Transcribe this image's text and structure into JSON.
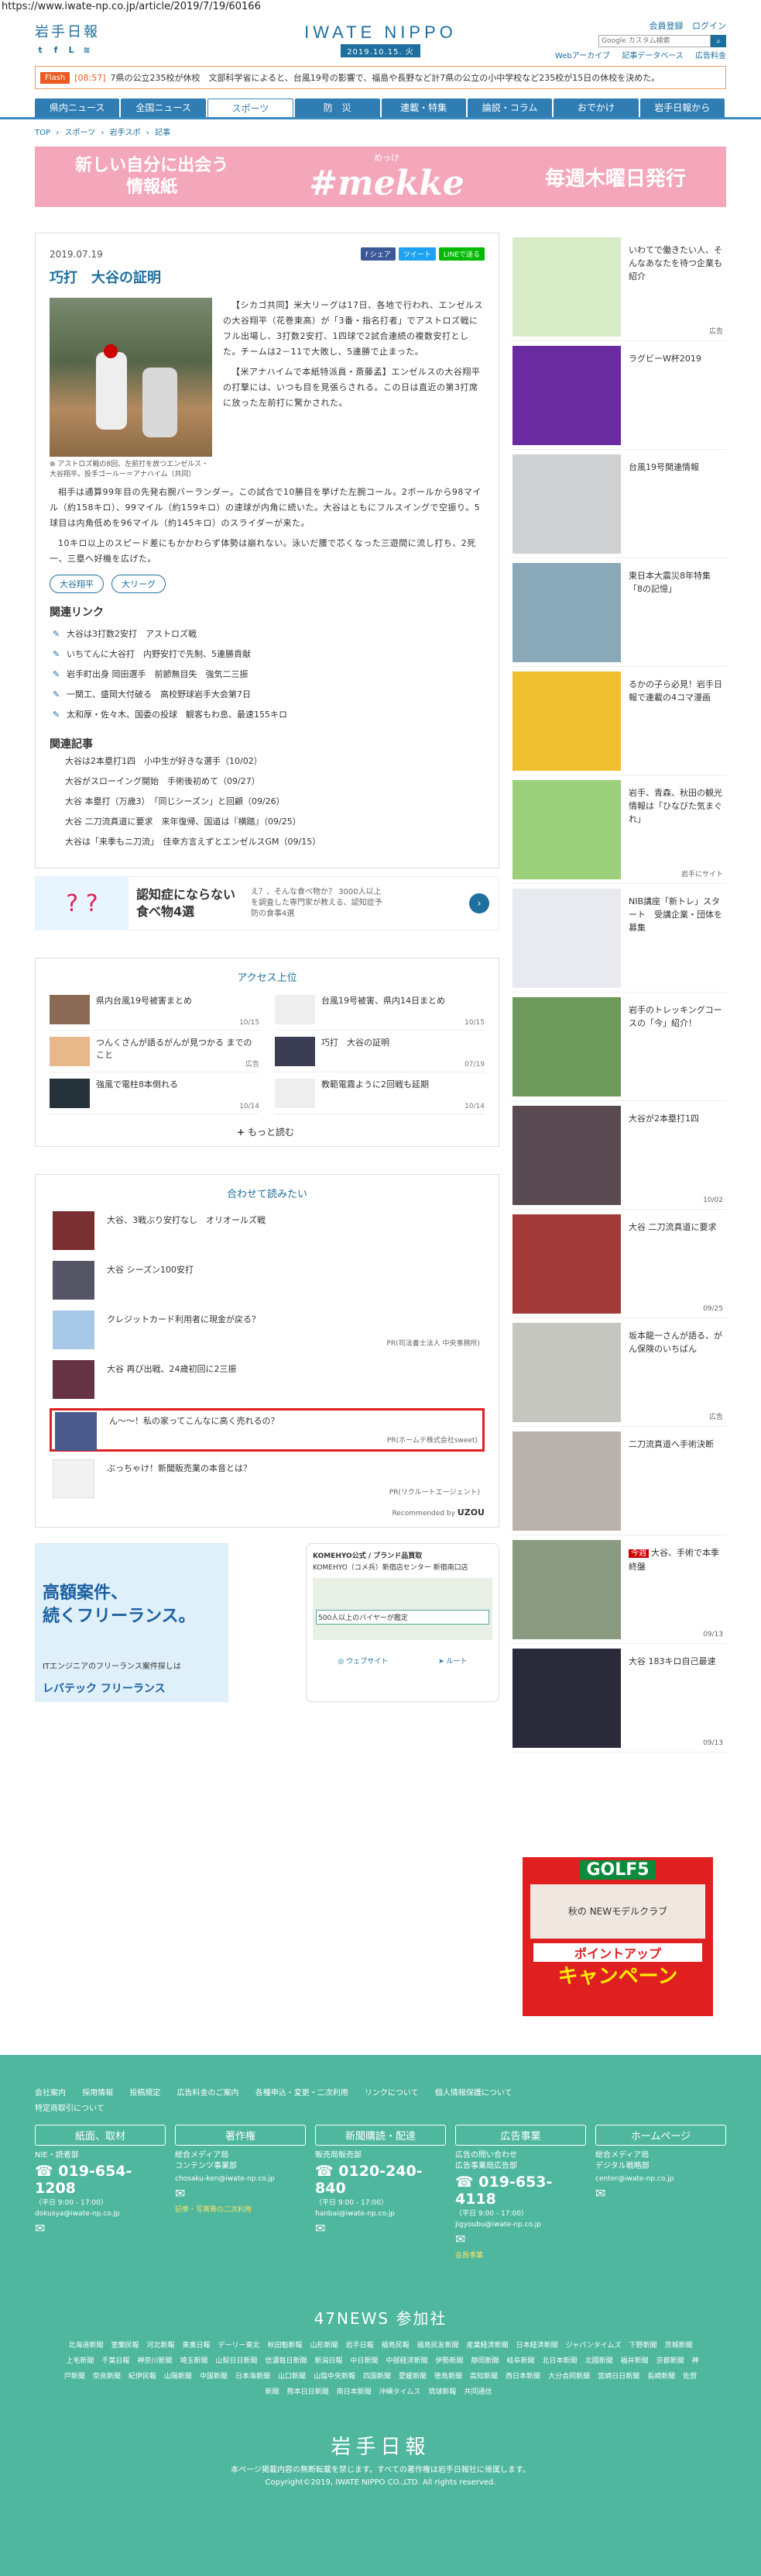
{
  "url": "https://www.iwate-np.co.jp/article/2019/7/19/60166",
  "header": {
    "logo_small": "岩手日報",
    "brand": "IWATE NIPPO",
    "date": "2019.10.15. 火",
    "links": [
      "会員登録",
      "ログイン"
    ],
    "search_placeholder": "Google カスタム検索",
    "sublinks": [
      "Webアーカイブ",
      "記事データベース",
      "広告料金"
    ]
  },
  "flash": {
    "tag": "Flash",
    "time": "[08:57]",
    "text": "7県の公立235校が休校　文部科学省によると、台風19号の影響で、福島や長野など計7県の公立の小中学校など235校が15日の休校を決めた。"
  },
  "nav": [
    "県内ニュース",
    "全国ニュース",
    "スポーツ",
    "防　災",
    "連載・特集",
    "論説・コラム",
    "おでかけ",
    "岩手日報から"
  ],
  "nav_active": 2,
  "breadcrumb": [
    "TOP",
    "›",
    "スポーツ",
    "›",
    "岩手スポ",
    "›",
    "記事"
  ],
  "banner": {
    "line1": "新しい自分に出会う",
    "line2": "情報紙",
    "ruby": "めっけ",
    "title": "#mekke",
    "right": "毎週木曜日発行"
  },
  "article": {
    "date": "2019.07.19",
    "share": [
      "f シェア",
      "ツイート",
      "LINEで送る"
    ],
    "title": "巧打　大谷の証明",
    "caption": "アストロズ戦の8回、左前打を放つエンゼルス・大谷翔平。投手ゴールー＝アナハイム（共同）",
    "p1": "【シカゴ共同】米大リーグは17日、各地で行われ、エンゼルスの大谷翔平（花巻東高）が「3番・指名打者」でアストロズ戦にフル出場し、3打数2安打、1四球で2試合連続の複数安打とした。チームは2－11で大敗し、5連勝で止まった。",
    "p2": "【米アナハイムで本紙特派員・斎藤孟】エンゼルスの大谷翔平の打撃には、いつも目を見張らされる。この日は直近の第3打席に放った左前打に驚かされた。",
    "p3": "相手は通算99年目の先発右腕バーランダー。この試合で10勝目を挙げた左腕コール。2ボールから98マイル（約158キロ）、99マイル（約159キロ）の速球が内角に続いた。大谷はともにフルスイングで空振り。5球目は内角低めを96マイル（約145キロ）のスライダーが来た。",
    "p4": "10キロ以上のスピード差にもかかわらず体勢は崩れない。泳いだ腰で芯くなった三遊間に流し打ち、2死一、三塁へ好機を広げた。",
    "tags": [
      "大谷翔平",
      "大リーグ"
    ]
  },
  "related_links": {
    "heading": "関連リンク",
    "items": [
      "大谷は3打数2安打　アストロズ戦",
      "いちてんに大谷打　内野安打で先制、5連勝貢献",
      "岩手町出身 岡田選手　前節無目失　強気二三振",
      "一関工、盛岡大付破る　高校野球岩手大会第7日",
      "太和厚・佐々木、国委の投球　観客もわ息、最速155キロ"
    ]
  },
  "related_news": {
    "heading": "関連記事",
    "items": [
      "大谷は2本塁打1四　小中生が好きな選手（10/02）",
      "大谷がスローイング開始　手術後初めて（09/27）",
      "大谷 本塁打（万歳3）　「同じシーズン」と回顧（09/26）",
      "大谷 二刀流真道に要求　来年復帰、国道は『横踏』（09/25）",
      "大谷は「来季もニ刀流」　佳幸方言えずとエンゼルスGM（09/15）"
    ]
  },
  "ad_mid": {
    "title": "認知症にならない\n食べ物4選",
    "sub": "え？、そんな食べ物か？ 3000人以上を調査した専門家が教える、認知症予防の食事4選"
  },
  "ranking": {
    "heading": "アクセス上位",
    "items": [
      {
        "title": "県内台風19号被害まとめ",
        "date": "10/15"
      },
      {
        "title": "台風19号被害、県内14日まとめ",
        "date": "10/15"
      },
      {
        "title": "つんくさんが語るがんが見つかる までのこと",
        "date": "広告"
      },
      {
        "title": "巧打　大谷の証明",
        "date": "07/19"
      },
      {
        "title": "強風で電柱8本倒れる",
        "date": "10/14"
      },
      {
        "title": "教範電霧ように2回戦も延期",
        "date": "10/14"
      }
    ],
    "more": "もっと読む"
  },
  "readmore": {
    "heading": "合わせて読みたい",
    "items": [
      {
        "title": "大谷、3戦ぶり安打なし　オリオールズ戦",
        "pr": ""
      },
      {
        "title": "大谷 シーズン100安打",
        "pr": ""
      },
      {
        "title": "クレジットカード利用者に現金が戻る？",
        "pr": "PR(司法書士法人 中央事務所)"
      },
      {
        "title": "大谷 再び出戦、24歳初回に2三振",
        "pr": ""
      },
      {
        "title": "ん～～！私の家ってこんなに高く売れるの？",
        "pr": "PR(ホームテ株式会社sweet)"
      },
      {
        "title": "ぶっちゃけ！新聞販売業の本音とは？",
        "pr": "PR(リクルートエージェント)"
      }
    ],
    "footer_label": "Recommended by",
    "footer_brand": "UZOU"
  },
  "bottom_ads": {
    "left_big": "高額案件、\n続くフリーランス。",
    "left_small": "ITエンジニアのフリーランス案件探しは",
    "left_logo": "レバテック フリーランス",
    "right_title": "KOMEHYO公式 / ブランド品買取",
    "right_sub": "KOMEHYO（コメ兵）新宿店センター 新宿南口店",
    "right_bar": "500人以上のバイヤーが鑑定",
    "right_btns": [
      "ウェブサイト",
      "ルート"
    ]
  },
  "sidebar": [
    {
      "text": "いわてで働きたい人、そんなあなたを待つ企業も紹介",
      "meta": "広告"
    },
    {
      "text": "ラグビーW杯2019",
      "meta": ""
    },
    {
      "text": "台風19号関連情報",
      "meta": ""
    },
    {
      "text": "東日本大震災8年特集「8の記憶」",
      "meta": ""
    },
    {
      "text": "るかの子ら必見！岩手日報で連載の4コマ漫画",
      "meta": ""
    },
    {
      "text": "岩手、青森、秋田の観光情報は「ひなびた気まぐれ」",
      "meta": "岩手にサイト"
    },
    {
      "text": "NIB講座「新トレ」スタート　受講企業・団体を募集",
      "meta": ""
    },
    {
      "text": "岩手のトレッキングコースの「今」紹介！",
      "meta": ""
    },
    {
      "text": "大谷が2本塁打1四",
      "meta": "10/02"
    },
    {
      "text": "大谷 二刀流真道に要求",
      "meta": "09/25"
    },
    {
      "text": "坂本龍一さんが語る、がん保険のいちばん",
      "meta": "広告"
    },
    {
      "text": "二刀流真道へ手術決断",
      "meta": ""
    },
    {
      "text": "大谷、手術で本季終盤",
      "meta": "09/13",
      "hot": "今週"
    },
    {
      "text": "大谷 183キロ自己最速",
      "meta": "09/13"
    }
  ],
  "golf_ad": {
    "g1": "GOLF5",
    "g2": "秋の NEWモデルクラブ",
    "g3": "ポイントアップ",
    "g4": "キャンペーン"
  },
  "footer": {
    "links": [
      "会社案内",
      "採用情報",
      "投稿規定",
      "広告料金のご案内",
      "各種申込・変更・二次利用",
      "リンクについて",
      "個人情報保護について",
      "特定商取引について"
    ],
    "cols": [
      {
        "head": "紙面、取材",
        "sub": "NIE・読者部",
        "tel": "019-654-1208",
        "hours": "（平日 9:00 - 17:00）",
        "mail": "dokusya@iwate-np.co.jp",
        "note": ""
      },
      {
        "head": "著作権",
        "sub": "総合メディア局\nコンテンツ事業部",
        "tel": "",
        "hours": "",
        "mail": "chosaku-ken@iwate-np.co.jp",
        "note": "記事・写真等の二次利用"
      },
      {
        "head": "新聞購読・配達",
        "sub": "販売局販売部",
        "tel": "0120-240-840",
        "hours": "（平日 9:00 - 17:00）",
        "mail": "hanbai@iwate-np.co.jp",
        "note": ""
      },
      {
        "head": "広告事業",
        "sub": "広告の問い合わせ\n広告事業局広告部",
        "tel": "019-653-4118",
        "hours": "（平日 9:00 - 17:00）",
        "mail": "jigyoubu@iwate-np.co.jp",
        "note": "会員事業"
      },
      {
        "head": "ホームページ",
        "sub": "総合メディア局\nデジタル戦略部",
        "tel": "",
        "hours": "",
        "mail": "center@iwate-np.co.jp",
        "note": ""
      }
    ],
    "n47": "47NEWS 参加社",
    "n47list": [
      "北海道新聞",
      "室蘭民報",
      "河北新報",
      "東奥日報",
      "デーリー東北",
      "秋田魁新報",
      "山形新聞",
      "岩手日報",
      "福島民報",
      "福島民友新聞",
      "産業経済新聞",
      "日本経済新聞",
      "ジャパンタイムズ",
      "下野新聞",
      "茨城新聞",
      "上毛新聞",
      "千葉日報",
      "神奈川新聞",
      "埼玉新聞",
      "山梨日日新聞",
      "信濃毎日新聞",
      "新潟日報",
      "中日新聞",
      "中部経済新聞",
      "伊勢新聞",
      "静岡新聞",
      "岐阜新聞",
      "北日本新聞",
      "北國新聞",
      "福井新聞",
      "京都新聞",
      "神戸新聞",
      "奈良新聞",
      "紀伊民報",
      "山陽新聞",
      "中国新聞",
      "日本海新聞",
      "山口新聞",
      "山陰中央新報",
      "四国新聞",
      "愛媛新聞",
      "徳島新聞",
      "高知新聞",
      "西日本新聞",
      "大分合同新聞",
      "宮崎日日新聞",
      "長崎新聞",
      "佐賀新聞",
      "熊本日日新聞",
      "南日本新聞",
      "沖縄タイムス",
      "琉球新報",
      "共同通信"
    ],
    "logo": "岩手日報",
    "copy1": "本ページ掲載内容の無断転載を禁じます。すべての著作権は岩手日報社に帰属します。",
    "copy2": "Copyright©2019, IWATE NIPPO CO.,LTD. All rights reserved."
  }
}
